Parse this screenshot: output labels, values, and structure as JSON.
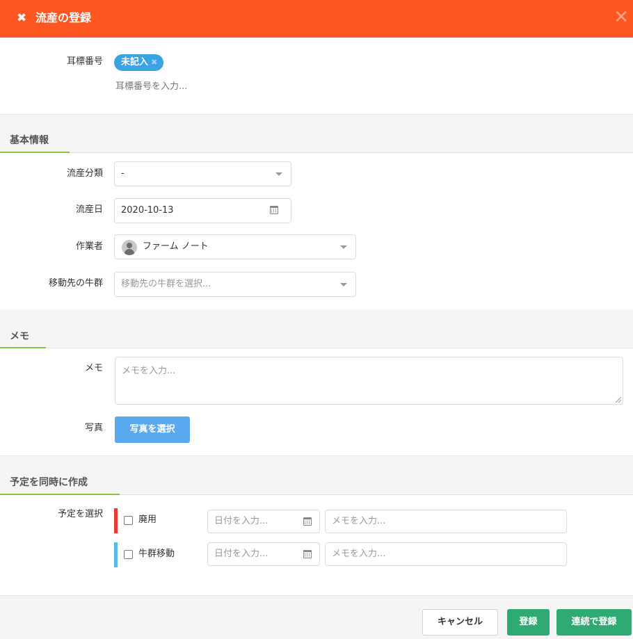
{
  "header": {
    "close_mark": "✖",
    "title": "流産の登録",
    "close_button": "✕"
  },
  "ear": {
    "label": "耳標番号",
    "tag": "未記入",
    "tag_remove": "✖",
    "placeholder": "耳標番号を入力..."
  },
  "basic": {
    "title": "基本情報",
    "type": {
      "label": "流産分類",
      "value": "-"
    },
    "date": {
      "label": "流産日",
      "value": "2020-10-13"
    },
    "worker": {
      "label": "作業者",
      "value": "ファーム ノート"
    },
    "group": {
      "label": "移動先の牛群",
      "placeholder": "移動先の牛群を選択..."
    }
  },
  "memo": {
    "title": "メモ",
    "label": "メモ",
    "placeholder": "メモを入力...",
    "photo_label": "写真",
    "photo_button": "写真を選択"
  },
  "schedule": {
    "title": "予定を同時に作成",
    "label": "予定を選択",
    "items": [
      {
        "name": "廃用",
        "color": "#e53935",
        "date_placeholder": "日付を入力...",
        "memo_placeholder": "メモを入力..."
      },
      {
        "name": "牛群移動",
        "color": "#5bb8ea",
        "date_placeholder": "日付を入力...",
        "memo_placeholder": "メモを入力..."
      }
    ]
  },
  "footer": {
    "cancel": "キャンセル",
    "register": "登録",
    "register_continue": "連続で登録"
  },
  "colors": {
    "header": "#ff5722",
    "accent_line": "#8bc34a",
    "primary": "#2eaa72",
    "photo_button": "#5aa9f0",
    "tag": "#3aa3e3"
  }
}
